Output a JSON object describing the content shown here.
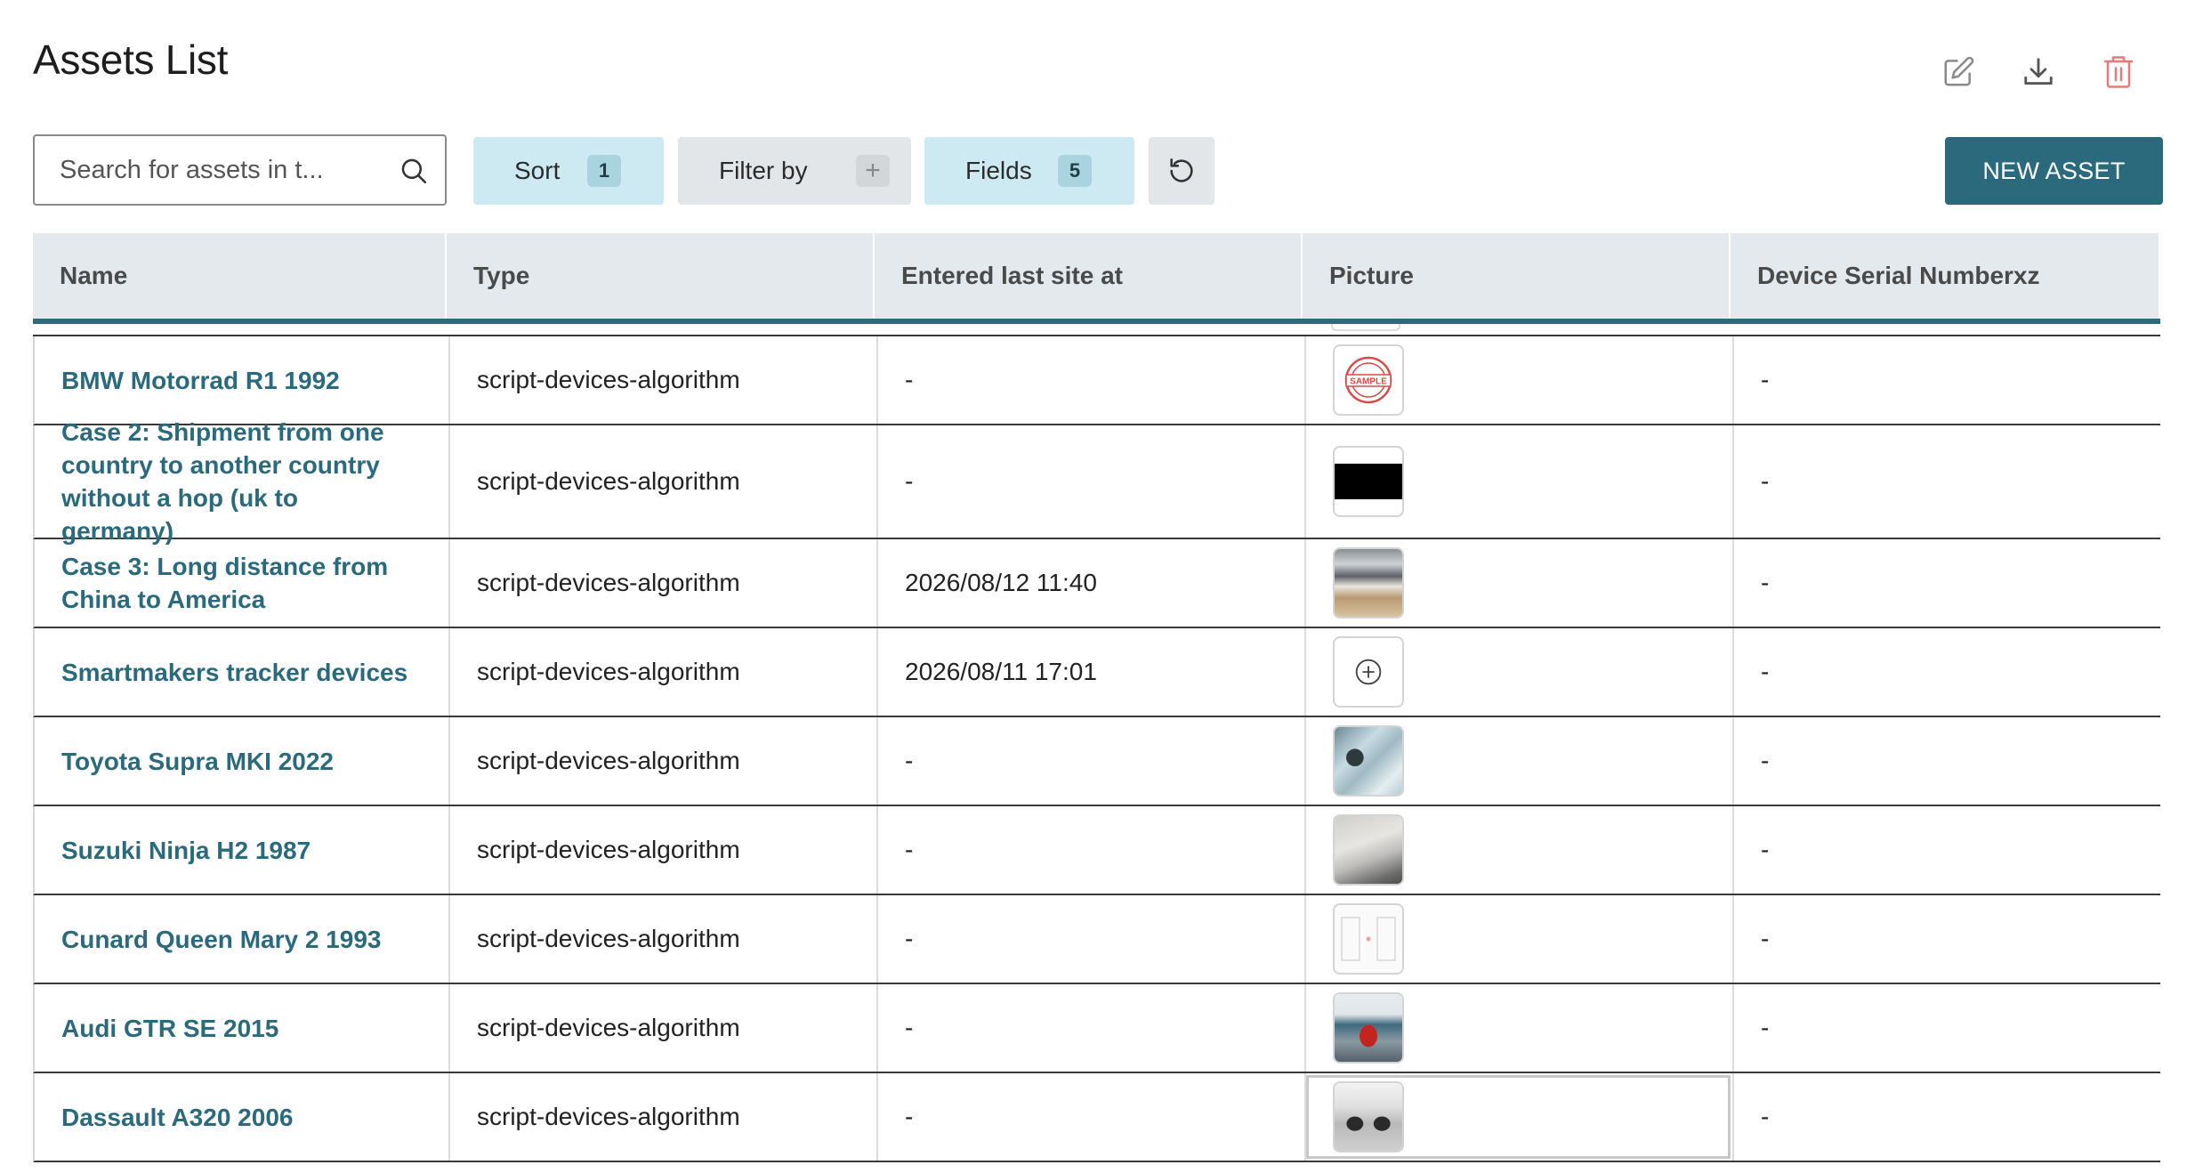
{
  "page": {
    "title": "Assets List"
  },
  "top_actions": {
    "edit": "edit-icon",
    "download": "download-icon",
    "delete": "trash-icon"
  },
  "toolbar": {
    "search_placeholder": "Search for assets in t...",
    "sort_label": "Sort",
    "sort_count": "1",
    "filter_label": "Filter by",
    "filter_badge": "+",
    "fields_label": "Fields",
    "fields_count": "5",
    "new_asset_label": "NEW ASSET"
  },
  "table": {
    "columns": [
      "Name",
      "Type",
      "Entered last site at",
      "Picture",
      "Device Serial Numberxz"
    ],
    "rows": [
      {
        "name": "BMW Motorrad R1 1992",
        "type": "script-devices-algorithm",
        "entered": "-",
        "picture": "sample-stamp",
        "serial": "-"
      },
      {
        "name": "Case 2: Shipment from one country to another country without a hop (uk to germany)",
        "type": "script-devices-algorithm",
        "entered": "-",
        "picture": "black",
        "serial": "-"
      },
      {
        "name": "Case 3: Long distance from China to America",
        "type": "script-devices-algorithm",
        "entered": "2026/08/12 11:40",
        "picture": "photo-truck",
        "serial": "-"
      },
      {
        "name": "Smartmakers tracker devices",
        "type": "script-devices-algorithm",
        "entered": "2026/08/11 17:01",
        "picture": "add-picture",
        "serial": "-"
      },
      {
        "name": "Toyota Supra MKI 2022",
        "type": "script-devices-algorithm",
        "entered": "-",
        "picture": "photo-map",
        "serial": "-"
      },
      {
        "name": "Suzuki Ninja H2 1987",
        "type": "script-devices-algorithm",
        "entered": "-",
        "picture": "photo-document",
        "serial": "-"
      },
      {
        "name": "Cunard Queen Mary 2 1993",
        "type": "script-devices-algorithm",
        "entered": "-",
        "picture": "photo-form",
        "serial": "-"
      },
      {
        "name": "Audi GTR SE 2015",
        "type": "script-devices-algorithm",
        "entered": "-",
        "picture": "photo-red-car",
        "serial": "-"
      },
      {
        "name": "Dassault A320 2006",
        "type": "script-devices-algorithm",
        "entered": "-",
        "picture": "photo-cars",
        "serial": "-"
      }
    ]
  },
  "colors": {
    "accent": "#2b6a7c",
    "chip_active": "#cdeaf2",
    "chip_inactive": "#e3e6e8",
    "header_bg": "#e3e9ec",
    "danger": "#e07d7d"
  }
}
